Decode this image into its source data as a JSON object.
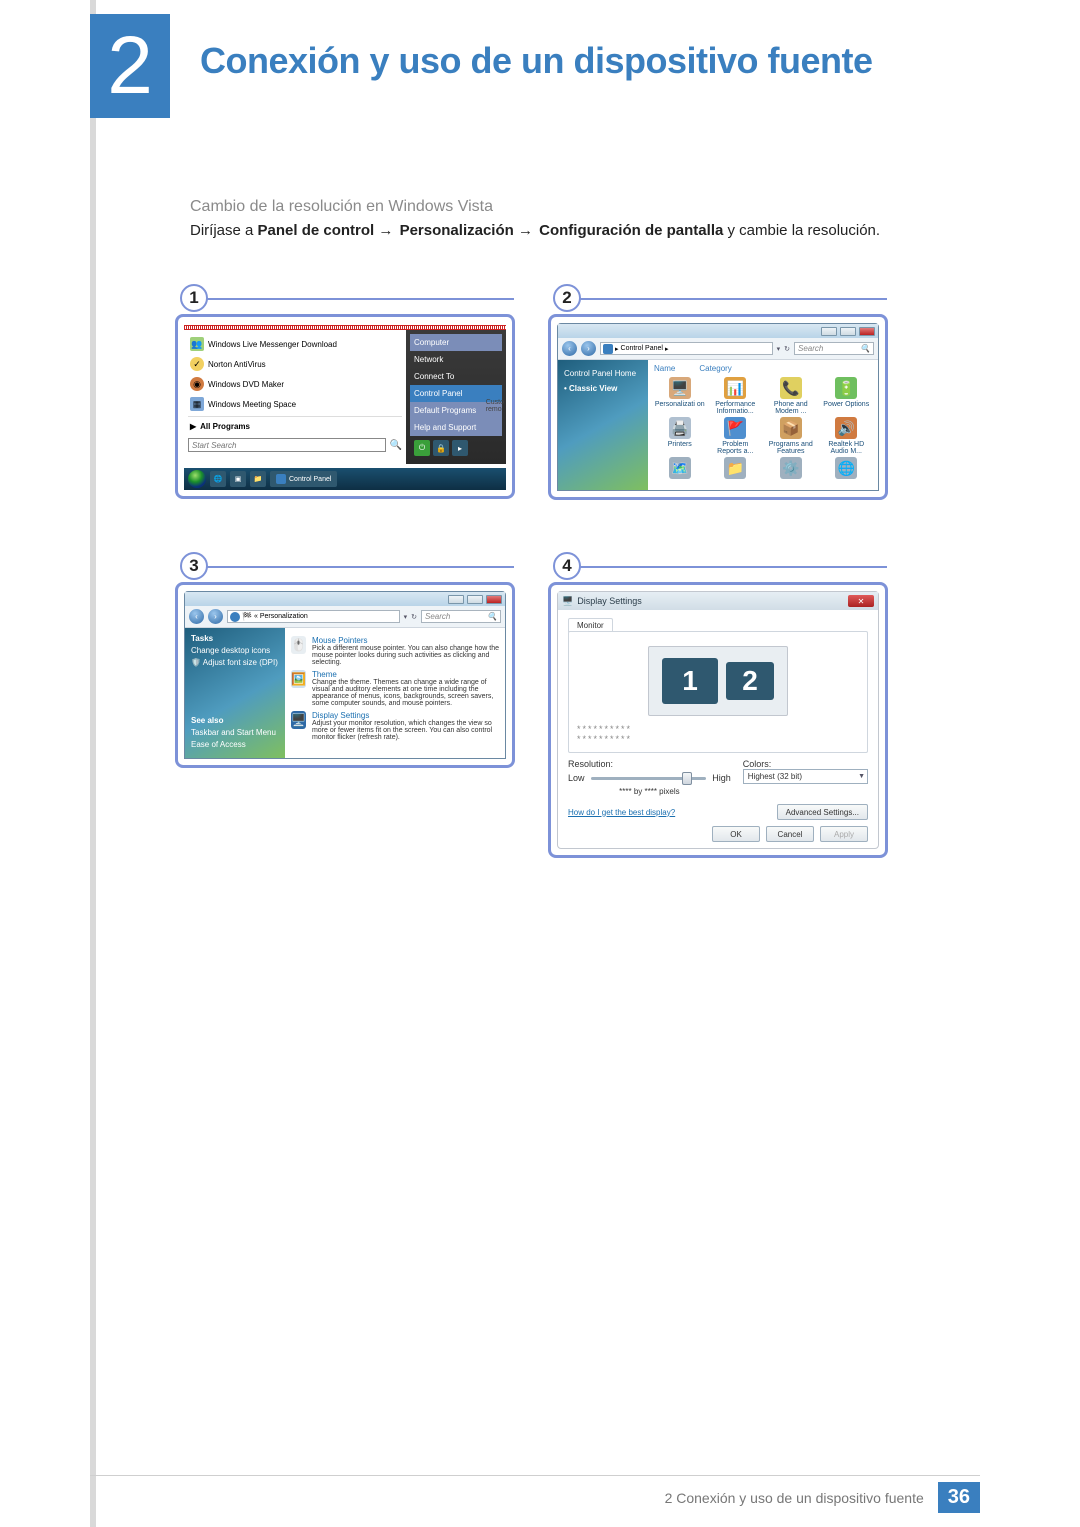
{
  "chapter": {
    "number": "2",
    "title": "Conexión y uso de un dispositivo fuente"
  },
  "section_subtitle": "Cambio de la resolución en Windows Vista",
  "instruction": {
    "lead": "Diríjase a ",
    "p1": "Panel de control",
    "p2": "Personalización",
    "p3": "Configuración de pantalla",
    "tail": " y cambie la resolución."
  },
  "steps": {
    "n1": "1",
    "n2": "2",
    "n3": "3",
    "n4": "4"
  },
  "panel1": {
    "menu_items": {
      "wlm": "Windows Live Messenger Download",
      "nav": "Norton AntiVirus",
      "dvd": "Windows DVD Maker",
      "wms": "Windows Meeting Space",
      "all": "All Programs"
    },
    "right": {
      "computer": "Computer",
      "network": "Network",
      "connect": "Connect To",
      "cp": "Control Panel",
      "dp": "Default Programs",
      "hs": "Help and Support"
    },
    "cust_top": "Custo",
    "cust_bot": "remo",
    "search_placeholder": "Start Search",
    "taskbar_label": "Control Panel"
  },
  "panel2": {
    "breadcrumb": "Control Panel",
    "search_placeholder": "Search",
    "side": {
      "home": "Control Panel Home",
      "classic": "Classic View"
    },
    "headers": {
      "name": "Name",
      "cat": "Category"
    },
    "items": [
      {
        "label": "Personalizati on",
        "bg": "#d8a87a",
        "glyph": "🖥️"
      },
      {
        "label": "Performance Informatio...",
        "bg": "#e0a040",
        "glyph": "📊"
      },
      {
        "label": "Phone and Modem ...",
        "bg": "#e0d060",
        "glyph": "📞"
      },
      {
        "label": "Power Options",
        "bg": "#6fbf5f",
        "glyph": "🔋"
      },
      {
        "label": "Printers",
        "bg": "#b0c0d0",
        "glyph": "🖨️"
      },
      {
        "label": "Problem Reports a...",
        "bg": "#4f8fcf",
        "glyph": "🚩"
      },
      {
        "label": "Programs and Features",
        "bg": "#d0a060",
        "glyph": "📦"
      },
      {
        "label": "Realtek HD Audio M...",
        "bg": "#d07a40",
        "glyph": "🔊"
      },
      {
        "label": "",
        "bg": "#9fb0bf",
        "glyph": "🗺️"
      },
      {
        "label": "",
        "bg": "#9fb0bf",
        "glyph": "📁"
      },
      {
        "label": "",
        "bg": "#9fb0bf",
        "glyph": "⚙️"
      },
      {
        "label": "",
        "bg": "#9fb0bf",
        "glyph": "🌐"
      }
    ]
  },
  "panel3": {
    "breadcrumb": "Personalization",
    "search_placeholder": "Search",
    "side": {
      "tasks_hdr": "Tasks",
      "t1": "Change desktop icons",
      "t2": "Adjust font size (DPI)",
      "see_also": "See also",
      "sa1": "Taskbar and Start Menu",
      "sa2": "Ease of Access"
    },
    "items": [
      {
        "title": "Mouse Pointers",
        "desc": "Pick a different mouse pointer. You can also change how the mouse pointer looks during such activities as clicking and selecting."
      },
      {
        "title": "Theme",
        "desc": "Change the theme. Themes can change a wide range of visual and auditory elements at one time including the appearance of menus, icons, backgrounds, screen savers, some computer sounds, and mouse pointers."
      },
      {
        "title": "Display Settings",
        "desc": "Adjust your monitor resolution, which changes the view so more or fewer items fit on the screen. You can also control monitor flicker (refresh rate)."
      }
    ]
  },
  "panel4": {
    "title": "Display Settings",
    "tab": "Monitor",
    "identify_top": "**********",
    "identify_bot": "**********",
    "res_label": "Resolution:",
    "low": "Low",
    "high": "High",
    "by_pixels": "**** by **** pixels",
    "colors_label": "Colors:",
    "color_value": "Highest (32 bit)",
    "help_link": "How do I get the best display?",
    "adv_btn": "Advanced Settings...",
    "ok": "OK",
    "cancel": "Cancel",
    "apply": "Apply",
    "mon1": "1",
    "mon2": "2"
  },
  "footer": {
    "text": "2 Conexión y uso de un dispositivo fuente",
    "page": "36"
  }
}
